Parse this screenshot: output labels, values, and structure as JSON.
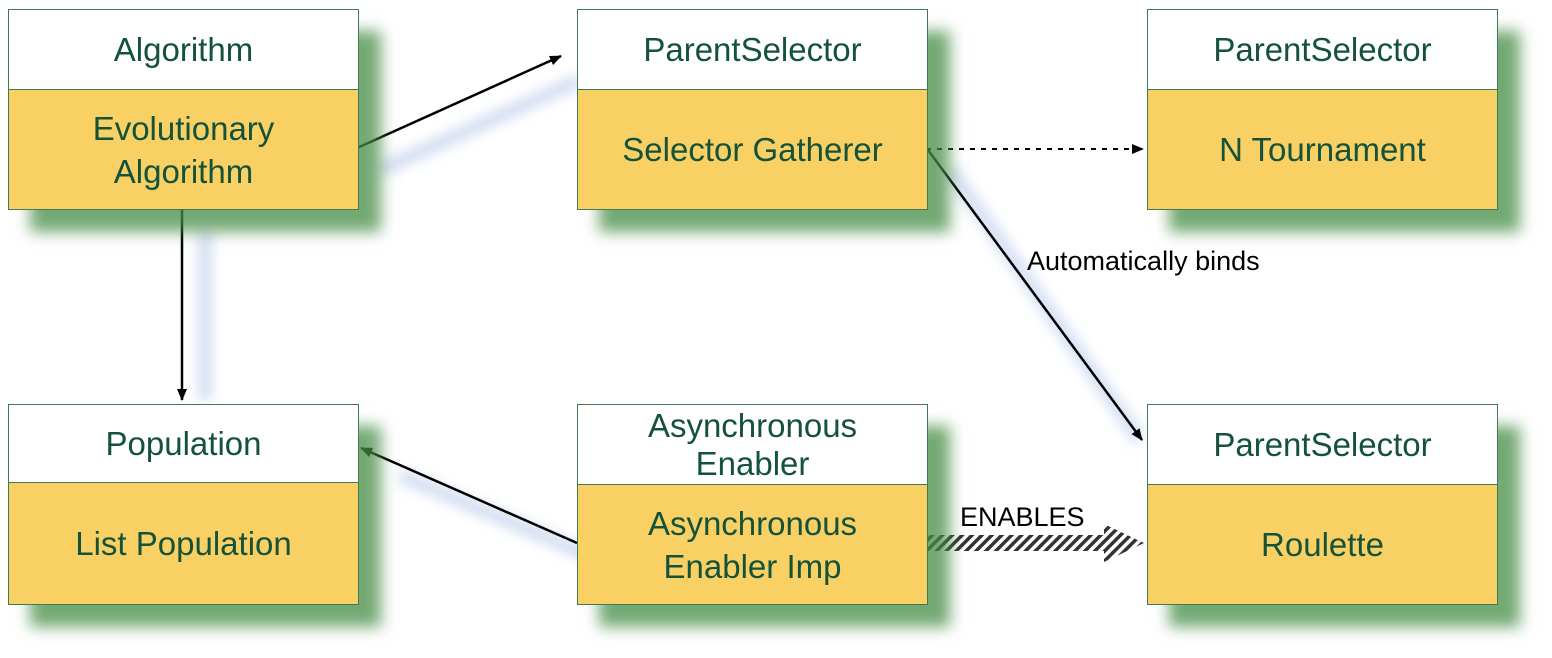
{
  "nodes": [
    {
      "id": "algorithm",
      "type": "Algorithm",
      "name": "Evolutionary\nAlgorithm"
    },
    {
      "id": "selector-gatherer",
      "type": "ParentSelector",
      "name": "Selector Gatherer"
    },
    {
      "id": "n-tournament",
      "type": "ParentSelector",
      "name": "N Tournament"
    },
    {
      "id": "population",
      "type": "Population",
      "name": "List Population"
    },
    {
      "id": "async-enabler",
      "type": "Asynchronous\nEnabler",
      "name": "Asynchronous\nEnabler Imp"
    },
    {
      "id": "roulette",
      "type": "ParentSelector",
      "name": "Roulette"
    }
  ],
  "edges": [
    {
      "from": "algorithm",
      "to": "selector-gatherer",
      "style": "solid"
    },
    {
      "from": "algorithm",
      "to": "population",
      "style": "solid"
    },
    {
      "from": "selector-gatherer",
      "to": "n-tournament",
      "style": "dotted"
    },
    {
      "from": "selector-gatherer",
      "to": "roulette",
      "style": "solid",
      "label": "Automatically binds"
    },
    {
      "from": "async-enabler",
      "to": "population",
      "style": "solid"
    },
    {
      "from": "async-enabler",
      "to": "roulette",
      "style": "hatched",
      "label": "ENABLES"
    }
  ],
  "colors": {
    "header": "#ffffff",
    "body": "#f8d064",
    "text": "#14523a",
    "shadow": "#468c46"
  }
}
